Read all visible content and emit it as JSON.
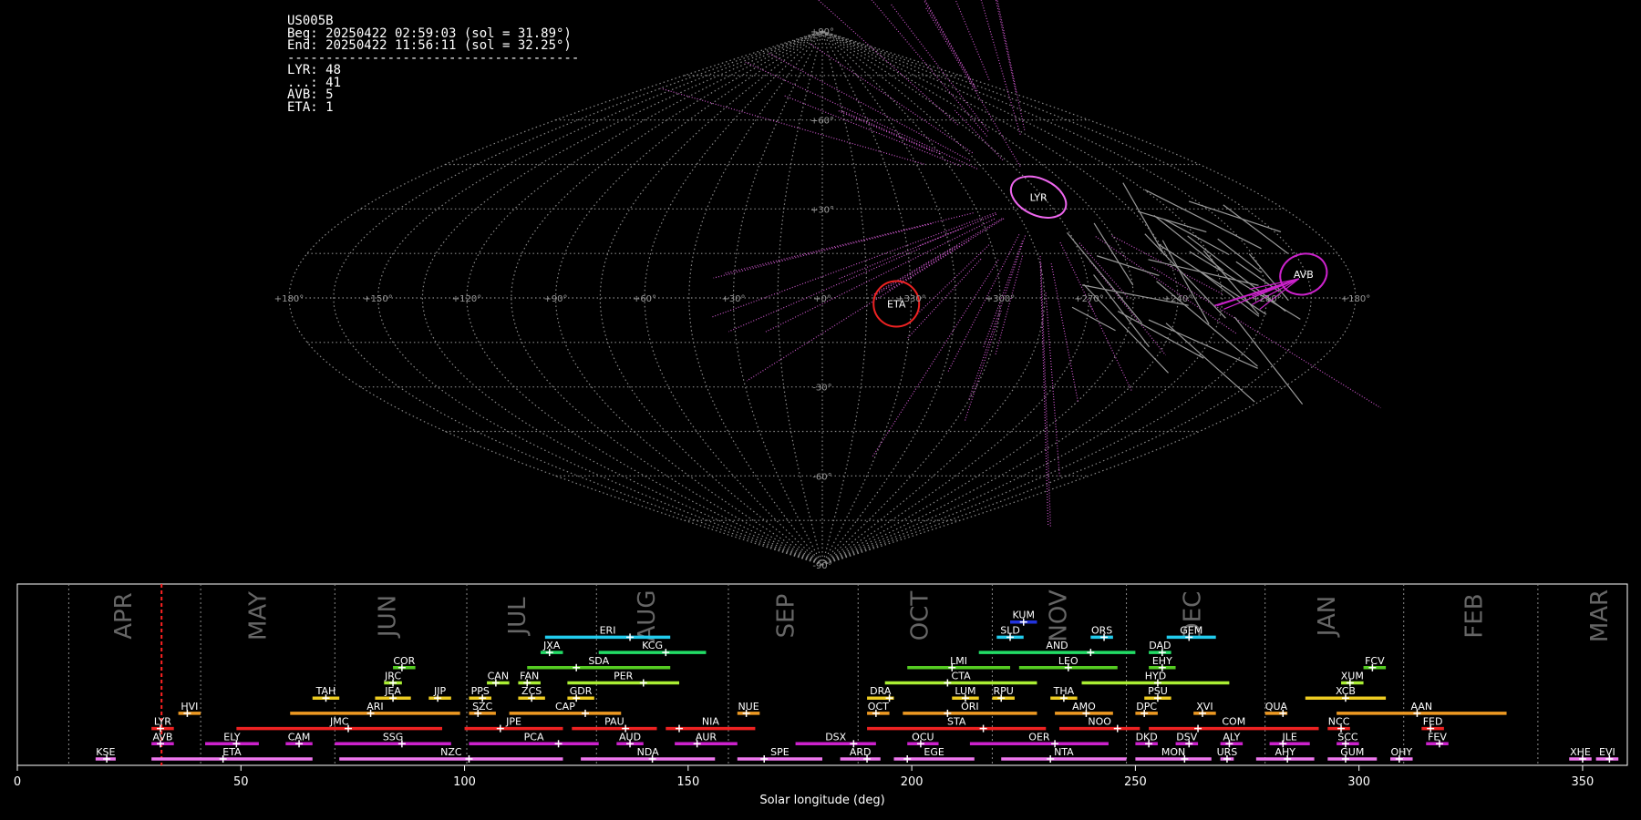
{
  "info": {
    "station": "US005B",
    "begin": "Beg: 20250422 02:59:03 (sol = 31.89°)",
    "end": "End: 20250422 11:56:11 (sol = 32.25°)",
    "separator": "--------------------------------------",
    "counts": [
      "LYR: 48",
      "...: 41",
      "AVB: 5",
      "ETA: 1"
    ]
  },
  "colors": {
    "background": "#000000",
    "grid": "#888888",
    "lyr": "#ee66ee",
    "avb": "#cc22cc",
    "eta": "#ee2222",
    "sporadic": "#999999",
    "current_sol": "#ff2222"
  },
  "chart_data": [
    {
      "type": "scatter",
      "projection": "sinusoidal",
      "grid": true,
      "lon_tick_labels": [
        "+180°",
        "+150°",
        "+120°",
        "+90°",
        "+60°",
        "+30°",
        "+0°",
        "+330°",
        "+300°",
        "+270°",
        "+240°",
        "+210°",
        "+180°"
      ],
      "lat_tick_labels": [
        "+90°",
        "+60°",
        "+30°",
        "-30°",
        "-60°",
        "-90°"
      ],
      "radiants": [
        {
          "name": "LYR",
          "ra": 272,
          "dec": 34,
          "color": "#ee66ee",
          "count": 48
        },
        {
          "name": "AVB",
          "ra": 196,
          "dec": 8,
          "color": "#cc22cc",
          "count": 5
        },
        {
          "name": "ETA",
          "ra": 335,
          "dec": -2,
          "color": "#ee2222",
          "count": 1
        }
      ]
    },
    {
      "type": "bar",
      "xlabel": "Solar longitude (deg)",
      "xlim": [
        0,
        360
      ],
      "x_ticks": [
        0,
        50,
        100,
        150,
        200,
        250,
        300,
        350
      ],
      "grid": true,
      "current_sol": 32.25,
      "month_boundaries": [
        11.5,
        41,
        71,
        100.5,
        129.5,
        159,
        188,
        218,
        248,
        279,
        310,
        340
      ],
      "months": [
        {
          "name": "APR",
          "x": 24
        },
        {
          "name": "MAY",
          "x": 54
        },
        {
          "name": "JUN",
          "x": 83
        },
        {
          "name": "JUL",
          "x": 112
        },
        {
          "name": "AUG",
          "x": 141
        },
        {
          "name": "SEP",
          "x": 172
        },
        {
          "name": "OCT",
          "x": 202
        },
        {
          "name": "NOV",
          "x": 233
        },
        {
          "name": "DEC",
          "x": 263
        },
        {
          "name": "JAN",
          "x": 293
        },
        {
          "name": "FEB",
          "x": 326
        },
        {
          "name": "MAR",
          "x": 354
        }
      ],
      "showers": [
        {
          "name": "KSE",
          "start": 17.5,
          "end": 22,
          "peak": 20,
          "row": 0,
          "color": "#ee77ee"
        },
        {
          "name": "ETA",
          "start": 30,
          "end": 66,
          "peak": 46,
          "row": 0,
          "color": "#ee77ee"
        },
        {
          "name": "NZC",
          "start": 72,
          "end": 122,
          "peak": 101,
          "row": 0,
          "color": "#ee77ee"
        },
        {
          "name": "NDA",
          "start": 126,
          "end": 156,
          "peak": 142,
          "row": 0,
          "color": "#ee77ee"
        },
        {
          "name": "SPE",
          "start": 161,
          "end": 180,
          "peak": 167,
          "row": 0,
          "color": "#ee77ee"
        },
        {
          "name": "ARD",
          "start": 184,
          "end": 193,
          "peak": 190,
          "row": 0,
          "color": "#ee77ee"
        },
        {
          "name": "EGE",
          "start": 196,
          "end": 214,
          "peak": 199,
          "row": 0,
          "color": "#ee77ee"
        },
        {
          "name": "NTA",
          "start": 220,
          "end": 248,
          "peak": 231,
          "row": 0,
          "color": "#ee77ee"
        },
        {
          "name": "MON",
          "start": 250,
          "end": 267,
          "peak": 261,
          "row": 0,
          "color": "#ee77ee"
        },
        {
          "name": "URS",
          "start": 269,
          "end": 272,
          "peak": 270.5,
          "row": 0,
          "color": "#ee77ee"
        },
        {
          "name": "AHY",
          "start": 277,
          "end": 290,
          "peak": 284,
          "row": 0,
          "color": "#ee77ee"
        },
        {
          "name": "GUM",
          "start": 293,
          "end": 304,
          "peak": 297,
          "row": 0,
          "color": "#ee77ee"
        },
        {
          "name": "OHY",
          "start": 307,
          "end": 312,
          "peak": 309,
          "row": 0,
          "color": "#ee77ee"
        },
        {
          "name": "XHE",
          "start": 347,
          "end": 352,
          "peak": 350,
          "row": 0,
          "color": "#ee77ee"
        },
        {
          "name": "EVI",
          "start": 353,
          "end": 358,
          "peak": 356,
          "row": 0,
          "color": "#ee77ee"
        },
        {
          "name": "AVB",
          "start": 30,
          "end": 35,
          "peak": 32,
          "row": 1,
          "color": "#cc22cc"
        },
        {
          "name": "ELY",
          "start": 42,
          "end": 54,
          "peak": 49,
          "row": 1,
          "color": "#cc22cc"
        },
        {
          "name": "CAM",
          "start": 60,
          "end": 66,
          "peak": 63,
          "row": 1,
          "color": "#cc22cc"
        },
        {
          "name": "SSG",
          "start": 71,
          "end": 97,
          "peak": 86,
          "row": 1,
          "color": "#cc22cc"
        },
        {
          "name": "PCA",
          "start": 101,
          "end": 130,
          "peak": 121,
          "row": 1,
          "color": "#cc22cc"
        },
        {
          "name": "AUD",
          "start": 134,
          "end": 140,
          "peak": 137,
          "row": 1,
          "color": "#cc22cc"
        },
        {
          "name": "AUR",
          "start": 147,
          "end": 161,
          "peak": 152,
          "row": 1,
          "color": "#cc22cc"
        },
        {
          "name": "DSX",
          "start": 174,
          "end": 192,
          "peak": 187,
          "row": 1,
          "color": "#cc22cc"
        },
        {
          "name": "OCU",
          "start": 199,
          "end": 206,
          "peak": 202,
          "row": 1,
          "color": "#cc22cc"
        },
        {
          "name": "OER",
          "start": 213,
          "end": 244,
          "peak": 232,
          "row": 1,
          "color": "#cc22cc"
        },
        {
          "name": "DKD",
          "start": 250,
          "end": 255,
          "peak": 253,
          "row": 1,
          "color": "#cc22cc"
        },
        {
          "name": "DSV",
          "start": 259,
          "end": 264,
          "peak": 262,
          "row": 1,
          "color": "#cc22cc"
        },
        {
          "name": "ALY",
          "start": 269,
          "end": 274,
          "peak": 271,
          "row": 1,
          "color": "#cc22cc"
        },
        {
          "name": "JLE",
          "start": 280,
          "end": 289,
          "peak": 283,
          "row": 1,
          "color": "#cc22cc"
        },
        {
          "name": "SCC",
          "start": 295,
          "end": 300,
          "peak": 297,
          "row": 1,
          "color": "#cc22cc"
        },
        {
          "name": "FEV",
          "start": 315,
          "end": 320,
          "peak": 318,
          "row": 1,
          "color": "#cc22cc"
        },
        {
          "name": "LYR",
          "start": 30,
          "end": 35,
          "peak": 32,
          "row": 2,
          "color": "#ee2222"
        },
        {
          "name": "JMC",
          "start": 49,
          "end": 95,
          "peak": 74,
          "row": 2,
          "color": "#ee2222"
        },
        {
          "name": "JPE",
          "start": 100,
          "end": 122,
          "peak": 108,
          "row": 2,
          "color": "#ee2222"
        },
        {
          "name": "PAU",
          "start": 124,
          "end": 143,
          "peak": 136,
          "row": 2,
          "color": "#ee2222"
        },
        {
          "name": "NIA",
          "start": 145,
          "end": 165,
          "peak": 148,
          "row": 2,
          "color": "#ee2222"
        },
        {
          "name": "STA",
          "start": 190,
          "end": 230,
          "peak": 216,
          "row": 2,
          "color": "#ee2222"
        },
        {
          "name": "NOO",
          "start": 233,
          "end": 251,
          "peak": 246,
          "row": 2,
          "color": "#ee2222"
        },
        {
          "name": "COM",
          "start": 253,
          "end": 291,
          "peak": 264,
          "row": 2,
          "color": "#ee2222"
        },
        {
          "name": "NCC",
          "start": 293,
          "end": 298,
          "peak": 296,
          "row": 2,
          "color": "#ee2222"
        },
        {
          "name": "FED",
          "start": 314,
          "end": 319,
          "peak": 316,
          "row": 2,
          "color": "#ee2222"
        },
        {
          "name": "HVI",
          "start": 36,
          "end": 41,
          "peak": 38,
          "row": 3,
          "color": "#ee9922"
        },
        {
          "name": "ARI",
          "start": 61,
          "end": 99,
          "peak": 79,
          "row": 3,
          "color": "#ee9922"
        },
        {
          "name": "SZC",
          "start": 101,
          "end": 107,
          "peak": 103,
          "row": 3,
          "color": "#ee9922"
        },
        {
          "name": "CAP",
          "start": 110,
          "end": 135,
          "peak": 127,
          "row": 3,
          "color": "#ee9922"
        },
        {
          "name": "NUE",
          "start": 161,
          "end": 166,
          "peak": 163,
          "row": 3,
          "color": "#ee9922"
        },
        {
          "name": "OCT",
          "start": 190,
          "end": 195,
          "peak": 192,
          "row": 3,
          "color": "#ee9922"
        },
        {
          "name": "ORI",
          "start": 198,
          "end": 228,
          "peak": 208,
          "row": 3,
          "color": "#ee9922"
        },
        {
          "name": "AMO",
          "start": 232,
          "end": 245,
          "peak": 239,
          "row": 3,
          "color": "#ee9922"
        },
        {
          "name": "DPC",
          "start": 250,
          "end": 255,
          "peak": 252,
          "row": 3,
          "color": "#ee9922"
        },
        {
          "name": "XVI",
          "start": 263,
          "end": 268,
          "peak": 265,
          "row": 3,
          "color": "#ee9922"
        },
        {
          "name": "QUA",
          "start": 279,
          "end": 284,
          "peak": 283,
          "row": 3,
          "color": "#ee9922"
        },
        {
          "name": "AAN",
          "start": 295,
          "end": 333,
          "peak": 313,
          "row": 3,
          "color": "#ee9922"
        },
        {
          "name": "TAH",
          "start": 66,
          "end": 72,
          "peak": 69,
          "row": 4,
          "color": "#eecc22"
        },
        {
          "name": "JEA",
          "start": 80,
          "end": 88,
          "peak": 84,
          "row": 4,
          "color": "#eecc22"
        },
        {
          "name": "JIP",
          "start": 92,
          "end": 97,
          "peak": 94,
          "row": 4,
          "color": "#eecc22"
        },
        {
          "name": "PPS",
          "start": 101,
          "end": 106,
          "peak": 104,
          "row": 4,
          "color": "#eecc22"
        },
        {
          "name": "ZCS",
          "start": 112,
          "end": 118,
          "peak": 115,
          "row": 4,
          "color": "#eecc22"
        },
        {
          "name": "GDR",
          "start": 123,
          "end": 129,
          "peak": 125,
          "row": 4,
          "color": "#eecc22"
        },
        {
          "name": "DRA",
          "start": 190,
          "end": 196,
          "peak": 195,
          "row": 4,
          "color": "#eecc22"
        },
        {
          "name": "LUM",
          "start": 209,
          "end": 215,
          "peak": 212,
          "row": 4,
          "color": "#eecc22"
        },
        {
          "name": "RPU",
          "start": 218,
          "end": 223,
          "peak": 220,
          "row": 4,
          "color": "#eecc22"
        },
        {
          "name": "THA",
          "start": 231,
          "end": 237,
          "peak": 234,
          "row": 4,
          "color": "#eecc22"
        },
        {
          "name": "PSU",
          "start": 252,
          "end": 258,
          "peak": 255,
          "row": 4,
          "color": "#eecc22"
        },
        {
          "name": "XCB",
          "start": 288,
          "end": 306,
          "peak": 297,
          "row": 4,
          "color": "#eecc22"
        },
        {
          "name": "JRC",
          "start": 82,
          "end": 86,
          "peak": 84,
          "row": 5,
          "color": "#aaee33"
        },
        {
          "name": "CAN",
          "start": 105,
          "end": 110,
          "peak": 107,
          "row": 5,
          "color": "#aaee33"
        },
        {
          "name": "FAN",
          "start": 112,
          "end": 117,
          "peak": 114,
          "row": 5,
          "color": "#aaee33"
        },
        {
          "name": "PER",
          "start": 123,
          "end": 148,
          "peak": 140,
          "row": 5,
          "color": "#aaee33"
        },
        {
          "name": "CTA",
          "start": 194,
          "end": 228,
          "peak": 208,
          "row": 5,
          "color": "#aaee33"
        },
        {
          "name": "HYD",
          "start": 238,
          "end": 271,
          "peak": 255,
          "row": 5,
          "color": "#aaee33"
        },
        {
          "name": "XUM",
          "start": 296,
          "end": 301,
          "peak": 298,
          "row": 5,
          "color": "#aaee33"
        },
        {
          "name": "COR",
          "start": 84,
          "end": 89,
          "peak": 86,
          "row": 6,
          "color": "#55cc22"
        },
        {
          "name": "SDA",
          "start": 114,
          "end": 146,
          "peak": 125,
          "row": 6,
          "color": "#55cc22"
        },
        {
          "name": "LMI",
          "start": 199,
          "end": 222,
          "peak": 209,
          "row": 6,
          "color": "#55cc22"
        },
        {
          "name": "LEO",
          "start": 224,
          "end": 246,
          "peak": 235,
          "row": 6,
          "color": "#55cc22"
        },
        {
          "name": "EHY",
          "start": 253,
          "end": 259,
          "peak": 256,
          "row": 6,
          "color": "#55cc22"
        },
        {
          "name": "FCV",
          "start": 301,
          "end": 306,
          "peak": 303,
          "row": 6,
          "color": "#55cc22"
        },
        {
          "name": "JXA",
          "start": 117,
          "end": 122,
          "peak": 119,
          "row": 7,
          "color": "#22dd66"
        },
        {
          "name": "KCG",
          "start": 130,
          "end": 154,
          "peak": 145,
          "row": 7,
          "color": "#22dd66"
        },
        {
          "name": "AND",
          "start": 215,
          "end": 250,
          "peak": 240,
          "row": 7,
          "color": "#22dd66"
        },
        {
          "name": "DAD",
          "start": 253,
          "end": 258,
          "peak": 256,
          "row": 7,
          "color": "#22dd66"
        },
        {
          "name": "ERI",
          "start": 118,
          "end": 146,
          "peak": 137,
          "row": 8,
          "color": "#22ccee"
        },
        {
          "name": "SLD",
          "start": 219,
          "end": 225,
          "peak": 222,
          "row": 8,
          "color": "#22ccee"
        },
        {
          "name": "ORS",
          "start": 240,
          "end": 245,
          "peak": 243,
          "row": 8,
          "color": "#22ccee"
        },
        {
          "name": "GEM",
          "start": 257,
          "end": 268,
          "peak": 262,
          "row": 8,
          "color": "#22ccee"
        },
        {
          "name": "KUM",
          "start": 222,
          "end": 228,
          "peak": 225,
          "row": 9,
          "color": "#2233dd"
        }
      ]
    }
  ]
}
